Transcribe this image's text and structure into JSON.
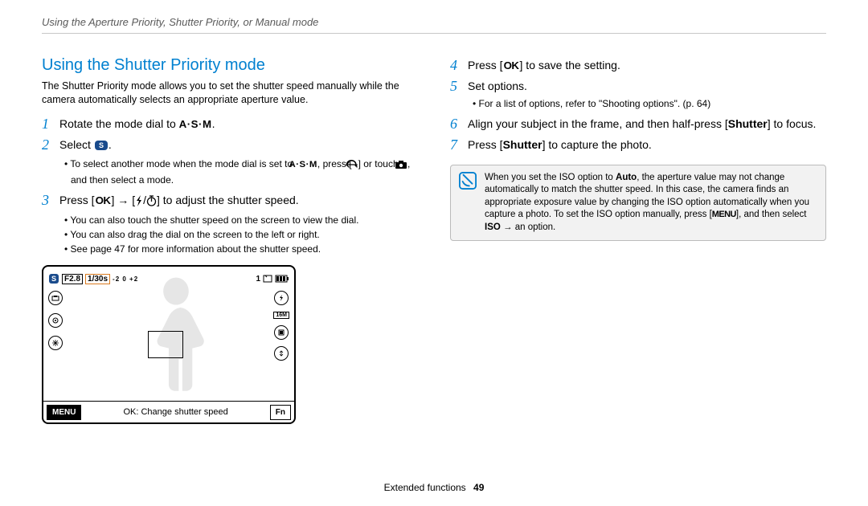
{
  "breadcrumb": "Using the Aperture Priority, Shutter Priority, or Manual mode",
  "heading": "Using the Shutter Priority mode",
  "intro": "The Shutter Priority mode allows you to set the shutter speed manually while the camera automatically selects an appropriate aperture value.",
  "icons": {
    "asm_label": "A·S·M",
    "ok_label": "OK",
    "menu_label": "MENU"
  },
  "steps_left": [
    {
      "n": "1",
      "pre": "Rotate the mode dial to ",
      "icon": "asm",
      "post": "."
    },
    {
      "n": "2",
      "pre": "Select ",
      "icon": "mode-s",
      "post": ".",
      "sub_rich": [
        [
          {
            "t": "To select another mode when the mode dial is set to "
          },
          {
            "icon": "asm"
          },
          {
            "t": ", press ["
          },
          {
            "icon": "back"
          },
          {
            "t": "] or touch "
          },
          {
            "icon": "camera"
          },
          {
            "t": ", and then select a mode."
          }
        ]
      ]
    },
    {
      "n": "3",
      "pre": "Press [",
      "icon": "ok",
      "mid": "] → [",
      "icon2": "flash",
      "mid2": "/",
      "icon3": "timer",
      "post": "] to adjust the shutter speed.",
      "sub": [
        "You can also touch the shutter speed on the screen to view the dial.",
        "You can also drag the dial on the screen to the left or right.",
        "See page 47 for more information about the shutter speed."
      ]
    }
  ],
  "steps_right": [
    {
      "n": "4",
      "pre": "Press [",
      "icon": "ok",
      "post": "] to save the setting."
    },
    {
      "n": "5",
      "pre": "Set options.",
      "sub": [
        "For a list of options, refer to \"Shooting options\". (p. 64)"
      ]
    },
    {
      "n": "6",
      "text_rich": [
        {
          "t": "Align your subject in the frame, and then half-press ["
        },
        {
          "b": "Shutter"
        },
        {
          "t": "] to focus."
        }
      ]
    },
    {
      "n": "7",
      "text_rich": [
        {
          "t": "Press ["
        },
        {
          "b": "Shutter"
        },
        {
          "t": "] to capture the photo."
        }
      ]
    }
  ],
  "note_rich": [
    {
      "t": "When you set the ISO option to "
    },
    {
      "b": "Auto"
    },
    {
      "t": ", the aperture value may not change automatically to match the shutter speed. In this case, the camera finds an appropriate exposure value by changing the ISO option automatically when you capture a photo. To set the ISO option manually, press ["
    },
    {
      "icon": "menu"
    },
    {
      "t": "], and then select "
    },
    {
      "b": "ISO"
    },
    {
      "t": " → an option."
    }
  ],
  "lcd": {
    "aperture": "F2.8",
    "shutter": "1/30s",
    "ev_marks": "-2  0  +2",
    "count": "1",
    "bar_text": "OK: Change shutter speed",
    "menu_btn": "MENU",
    "fn_btn": "Fn",
    "size_label": "16M"
  },
  "footer": {
    "section": "Extended functions",
    "page": "49"
  }
}
